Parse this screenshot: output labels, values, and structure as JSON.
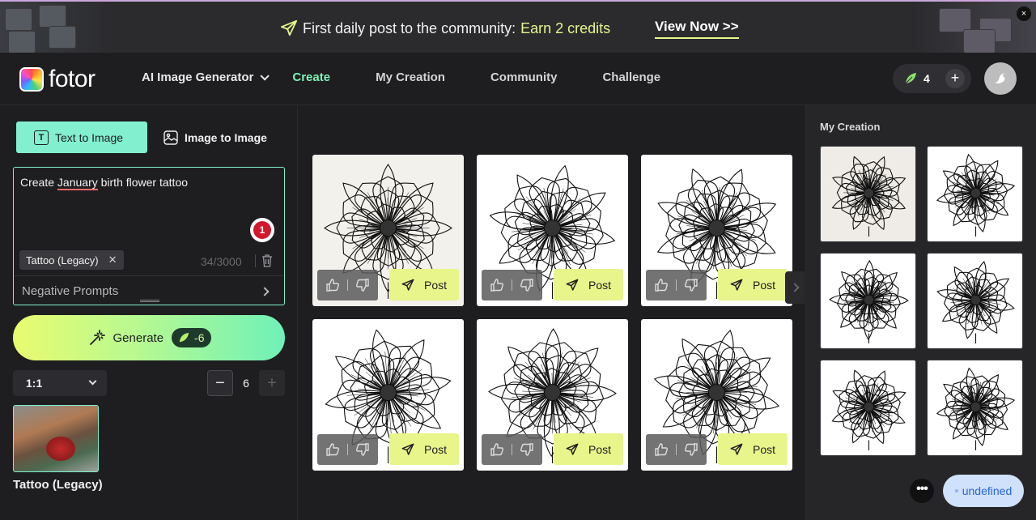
{
  "banner": {
    "text": "First daily post to the community:",
    "highlight": "Earn 2 credits",
    "cta": "View Now >>",
    "close": "×",
    "icon": "paper-plane-icon"
  },
  "header": {
    "logo": "fotor",
    "nav": [
      {
        "label": "AI Image Generator",
        "active": false,
        "dropdown": true
      },
      {
        "label": "Create",
        "active": true
      },
      {
        "label": "My Creation",
        "active": false
      },
      {
        "label": "Community",
        "active": false
      },
      {
        "label": "Challenge",
        "active": false
      }
    ],
    "credits": "4",
    "credits_plus": "+"
  },
  "left": {
    "tabs": [
      {
        "label": "Text to Image",
        "icon": "text-icon",
        "active": true
      },
      {
        "label": "Image to Image",
        "icon": "image-icon",
        "active": false
      }
    ],
    "prompt_before": "Create ",
    "prompt_flagged": "January",
    "prompt_after": " birth flower tattoo",
    "grammarly_count": "1",
    "style_chip": "Tattoo (Legacy)",
    "style_chip_close": "✕",
    "char_count": "34/3000",
    "negative_prompts": "Negative Prompts",
    "generate": "Generate",
    "generate_cost": "-6",
    "ratio": "1:1",
    "count_minus": "−",
    "count": "6",
    "count_plus": "+",
    "style_label": "Tattoo (Legacy)"
  },
  "grid": {
    "post_label": "Post",
    "cards": [
      {
        "id": "card-1"
      },
      {
        "id": "card-2"
      },
      {
        "id": "card-3"
      },
      {
        "id": "card-4"
      },
      {
        "id": "card-5"
      },
      {
        "id": "card-6"
      }
    ]
  },
  "right": {
    "title": "My Creation",
    "more": "•••",
    "pill": "undefined"
  },
  "colors": {
    "accent": "#82efcf",
    "active_nav": "#7ff2b7",
    "post_button": "#e8f58a",
    "banner_highlight": "#e6f58a"
  }
}
